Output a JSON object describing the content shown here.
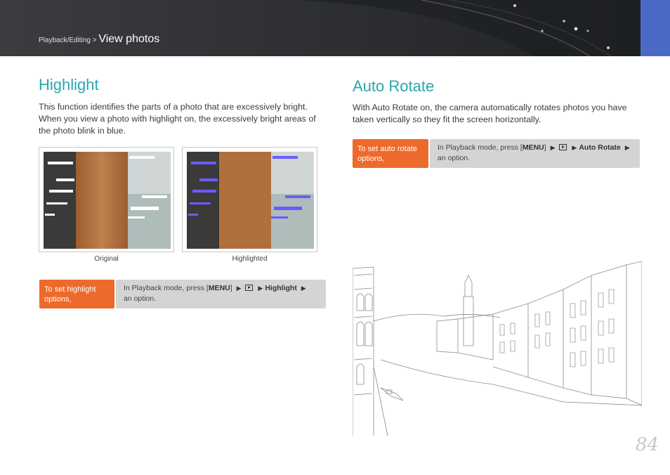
{
  "header": {
    "breadcrumb_parent": "Playback/Editing",
    "breadcrumb_sep": " > ",
    "breadcrumb_current": "View photos"
  },
  "highlight": {
    "title": "Highlight",
    "description": "This function identifies the parts of a photo that are excessively bright. When you view a photo with highlight on, the excessively bright areas of the photo blink in blue.",
    "captions": [
      "Original",
      "Highlighted"
    ],
    "step_label": "To set highlight options,",
    "step_desc_prefix": "In Playback mode, press [",
    "menu_key": "MENU",
    "step_desc_bracket_close": "]",
    "arrow": "▶",
    "option_name": "Highlight",
    "step_desc_suffix": "an option."
  },
  "auto_rotate": {
    "title": "Auto Rotate",
    "description": "With Auto Rotate on, the camera automatically rotates photos you have taken vertically so they fit the screen horizontally.",
    "step_label": "To set auto rotate options,",
    "step_desc_prefix": "In Playback mode, press [",
    "menu_key": "MENU",
    "step_desc_bracket_close": "]",
    "arrow": "▶",
    "option_name": "Auto Rotate",
    "step_desc_suffix": "an option."
  },
  "page_number": "84",
  "colors": {
    "accent_teal": "#2ba6ae",
    "step_orange": "#ee6a2c",
    "step_gray": "#d4d4d4",
    "header_tab_blue": "#4a69c4",
    "highlight_blue": "#6a5cff"
  },
  "icons": [
    "playback-settings-icon"
  ]
}
